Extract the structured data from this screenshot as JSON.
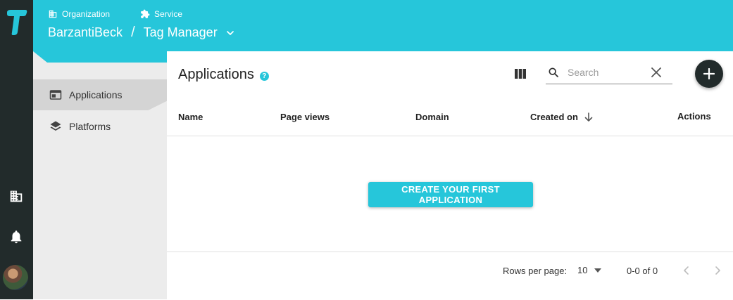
{
  "header": {
    "organization_label": "Organization",
    "service_label": "Service",
    "organization_name": "BarzantiBeck",
    "separator": "/",
    "service_name": "Tag Manager"
  },
  "secondary_nav": {
    "items": [
      {
        "label": "Applications",
        "icon": "application-window-icon",
        "active": true
      },
      {
        "label": "Platforms",
        "icon": "layers-icon",
        "active": false
      }
    ]
  },
  "main": {
    "title": "Applications",
    "help": "?",
    "search": {
      "placeholder": "Search",
      "value": ""
    },
    "table": {
      "columns": [
        "Name",
        "Page views",
        "Domain",
        "Created on",
        "Actions"
      ],
      "sort_column": "Created on",
      "sort_direction": "descending"
    },
    "empty_action_label": "CREATE YOUR FIRST APPLICATION",
    "pagination": {
      "rows_per_page_label": "Rows per page:",
      "rows_per_page_value": "10",
      "range_label": "0-0 of 0"
    }
  },
  "colors": {
    "accent": "#26c6da",
    "rail": "#222b2b",
    "secondary_nav": "#ececec"
  }
}
